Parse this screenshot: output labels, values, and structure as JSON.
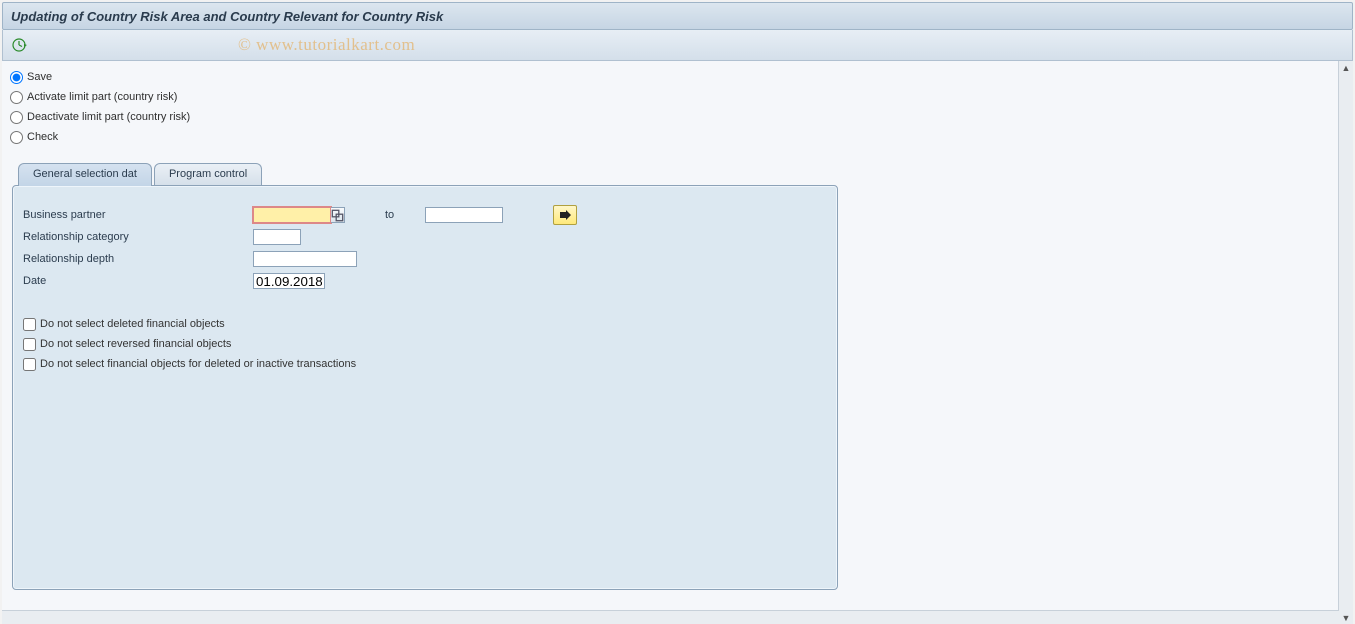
{
  "header": {
    "title": "Updating of Country Risk Area and Country Relevant for Country Risk"
  },
  "watermark": "© www.tutorialkart.com",
  "radios": {
    "save": "Save",
    "activate": "Activate limit part (country risk)",
    "deactivate": "Deactivate limit part (country risk)",
    "check": "Check"
  },
  "tabs": {
    "general": "General selection dat",
    "program": "Program control"
  },
  "form": {
    "bp_label": "Business partner",
    "bp_value": "",
    "to_label": "to",
    "bp_to_value": "",
    "relcat_label": "Relationship category",
    "relcat_value": "",
    "reldepth_label": "Relationship depth",
    "reldepth_value": "",
    "date_label": "Date",
    "date_value": "01.09.2018"
  },
  "checks": {
    "no_deleted": "Do not select deleted financial objects",
    "no_reversed": "Do not select reversed financial objects",
    "no_inactive": "Do not select financial objects for deleted or inactive transactions"
  }
}
